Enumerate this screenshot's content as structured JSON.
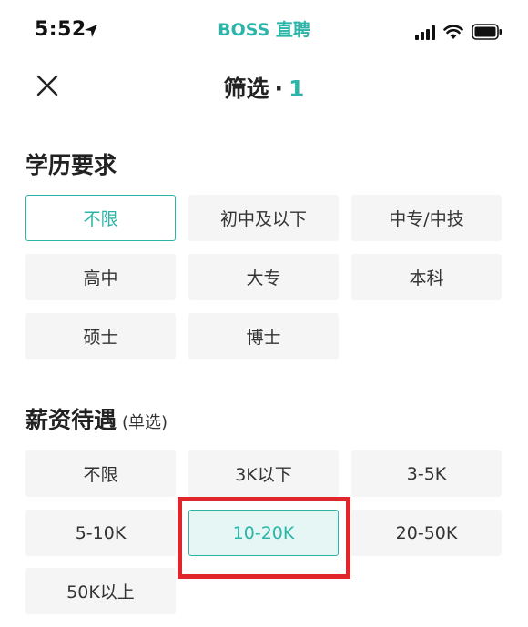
{
  "status_bar": {
    "time": "5:52",
    "app_brand": "BOSS 直聘"
  },
  "header": {
    "title": "筛选",
    "dot": "·",
    "count": "1"
  },
  "education": {
    "title": "学历要求",
    "options": [
      "不限",
      "初中及以下",
      "中专/中技",
      "高中",
      "大专",
      "本科",
      "硕士",
      "博士"
    ],
    "selected": "不限"
  },
  "salary": {
    "title": "薪资待遇",
    "subtitle": "(单选)",
    "options": [
      "不限",
      "3K以下",
      "3-5K",
      "5-10K",
      "10-20K",
      "20-50K",
      "50K以上"
    ],
    "selected": "10-20K"
  },
  "colors": {
    "accent": "#2bb5a8",
    "option_bg": "#f5f5f5",
    "highlight": "#e0262b"
  }
}
